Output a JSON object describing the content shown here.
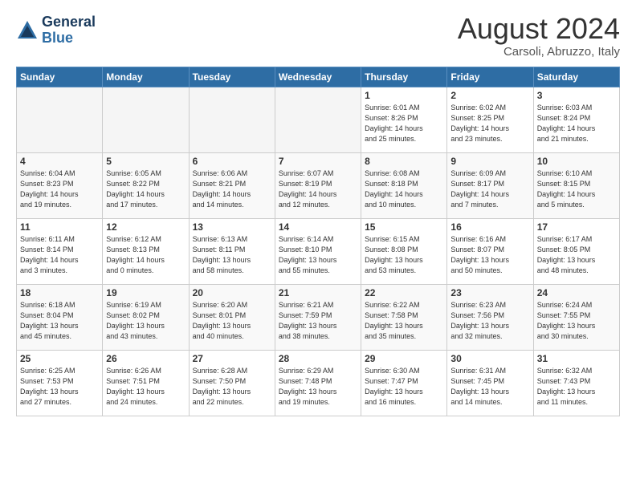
{
  "header": {
    "logo_line1": "General",
    "logo_line2": "Blue",
    "month": "August 2024",
    "location": "Carsoli, Abruzzo, Italy"
  },
  "weekdays": [
    "Sunday",
    "Monday",
    "Tuesday",
    "Wednesday",
    "Thursday",
    "Friday",
    "Saturday"
  ],
  "weeks": [
    [
      {
        "day": "",
        "info": ""
      },
      {
        "day": "",
        "info": ""
      },
      {
        "day": "",
        "info": ""
      },
      {
        "day": "",
        "info": ""
      },
      {
        "day": "1",
        "info": "Sunrise: 6:01 AM\nSunset: 8:26 PM\nDaylight: 14 hours\nand 25 minutes."
      },
      {
        "day": "2",
        "info": "Sunrise: 6:02 AM\nSunset: 8:25 PM\nDaylight: 14 hours\nand 23 minutes."
      },
      {
        "day": "3",
        "info": "Sunrise: 6:03 AM\nSunset: 8:24 PM\nDaylight: 14 hours\nand 21 minutes."
      }
    ],
    [
      {
        "day": "4",
        "info": "Sunrise: 6:04 AM\nSunset: 8:23 PM\nDaylight: 14 hours\nand 19 minutes."
      },
      {
        "day": "5",
        "info": "Sunrise: 6:05 AM\nSunset: 8:22 PM\nDaylight: 14 hours\nand 17 minutes."
      },
      {
        "day": "6",
        "info": "Sunrise: 6:06 AM\nSunset: 8:21 PM\nDaylight: 14 hours\nand 14 minutes."
      },
      {
        "day": "7",
        "info": "Sunrise: 6:07 AM\nSunset: 8:19 PM\nDaylight: 14 hours\nand 12 minutes."
      },
      {
        "day": "8",
        "info": "Sunrise: 6:08 AM\nSunset: 8:18 PM\nDaylight: 14 hours\nand 10 minutes."
      },
      {
        "day": "9",
        "info": "Sunrise: 6:09 AM\nSunset: 8:17 PM\nDaylight: 14 hours\nand 7 minutes."
      },
      {
        "day": "10",
        "info": "Sunrise: 6:10 AM\nSunset: 8:15 PM\nDaylight: 14 hours\nand 5 minutes."
      }
    ],
    [
      {
        "day": "11",
        "info": "Sunrise: 6:11 AM\nSunset: 8:14 PM\nDaylight: 14 hours\nand 3 minutes."
      },
      {
        "day": "12",
        "info": "Sunrise: 6:12 AM\nSunset: 8:13 PM\nDaylight: 14 hours\nand 0 minutes."
      },
      {
        "day": "13",
        "info": "Sunrise: 6:13 AM\nSunset: 8:11 PM\nDaylight: 13 hours\nand 58 minutes."
      },
      {
        "day": "14",
        "info": "Sunrise: 6:14 AM\nSunset: 8:10 PM\nDaylight: 13 hours\nand 55 minutes."
      },
      {
        "day": "15",
        "info": "Sunrise: 6:15 AM\nSunset: 8:08 PM\nDaylight: 13 hours\nand 53 minutes."
      },
      {
        "day": "16",
        "info": "Sunrise: 6:16 AM\nSunset: 8:07 PM\nDaylight: 13 hours\nand 50 minutes."
      },
      {
        "day": "17",
        "info": "Sunrise: 6:17 AM\nSunset: 8:05 PM\nDaylight: 13 hours\nand 48 minutes."
      }
    ],
    [
      {
        "day": "18",
        "info": "Sunrise: 6:18 AM\nSunset: 8:04 PM\nDaylight: 13 hours\nand 45 minutes."
      },
      {
        "day": "19",
        "info": "Sunrise: 6:19 AM\nSunset: 8:02 PM\nDaylight: 13 hours\nand 43 minutes."
      },
      {
        "day": "20",
        "info": "Sunrise: 6:20 AM\nSunset: 8:01 PM\nDaylight: 13 hours\nand 40 minutes."
      },
      {
        "day": "21",
        "info": "Sunrise: 6:21 AM\nSunset: 7:59 PM\nDaylight: 13 hours\nand 38 minutes."
      },
      {
        "day": "22",
        "info": "Sunrise: 6:22 AM\nSunset: 7:58 PM\nDaylight: 13 hours\nand 35 minutes."
      },
      {
        "day": "23",
        "info": "Sunrise: 6:23 AM\nSunset: 7:56 PM\nDaylight: 13 hours\nand 32 minutes."
      },
      {
        "day": "24",
        "info": "Sunrise: 6:24 AM\nSunset: 7:55 PM\nDaylight: 13 hours\nand 30 minutes."
      }
    ],
    [
      {
        "day": "25",
        "info": "Sunrise: 6:25 AM\nSunset: 7:53 PM\nDaylight: 13 hours\nand 27 minutes."
      },
      {
        "day": "26",
        "info": "Sunrise: 6:26 AM\nSunset: 7:51 PM\nDaylight: 13 hours\nand 24 minutes."
      },
      {
        "day": "27",
        "info": "Sunrise: 6:28 AM\nSunset: 7:50 PM\nDaylight: 13 hours\nand 22 minutes."
      },
      {
        "day": "28",
        "info": "Sunrise: 6:29 AM\nSunset: 7:48 PM\nDaylight: 13 hours\nand 19 minutes."
      },
      {
        "day": "29",
        "info": "Sunrise: 6:30 AM\nSunset: 7:47 PM\nDaylight: 13 hours\nand 16 minutes."
      },
      {
        "day": "30",
        "info": "Sunrise: 6:31 AM\nSunset: 7:45 PM\nDaylight: 13 hours\nand 14 minutes."
      },
      {
        "day": "31",
        "info": "Sunrise: 6:32 AM\nSunset: 7:43 PM\nDaylight: 13 hours\nand 11 minutes."
      }
    ]
  ]
}
